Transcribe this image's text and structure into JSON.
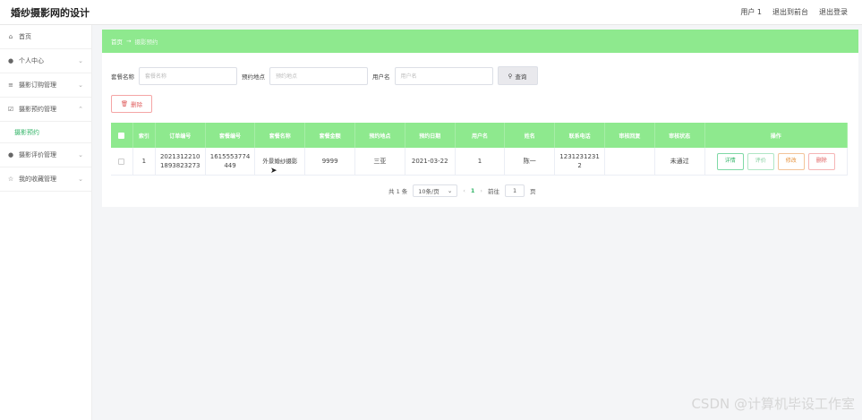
{
  "header": {
    "app_title": "婚纱摄影网的设计",
    "user": "用户 1",
    "back_front": "退出到前台",
    "logout": "退出登录"
  },
  "sidebar": {
    "items": [
      {
        "label": "首页",
        "icon": "home-icon"
      },
      {
        "label": "个人中心",
        "icon": "user-icon"
      },
      {
        "label": "摄影订购管理",
        "icon": "list-icon"
      },
      {
        "label": "摄影预约管理",
        "icon": "calendar-check-icon"
      },
      {
        "label": "摄影预约",
        "sub": true
      },
      {
        "label": "摄影评价管理",
        "icon": "user-icon"
      },
      {
        "label": "我的收藏管理",
        "icon": "star-icon"
      }
    ]
  },
  "breadcrumb": {
    "home": "首页",
    "arrow": "→",
    "current": "摄影预约"
  },
  "search": {
    "package_label": "套餐名称",
    "package_placeholder": "套餐名称",
    "location_label": "预约地点",
    "location_placeholder": "预约地点",
    "username_label": "用户名",
    "username_placeholder": "用户名",
    "search_button": "查询"
  },
  "toolbar": {
    "delete_button": "删除"
  },
  "table": {
    "columns": [
      "索引",
      "订单编号",
      "套餐编号",
      "套餐名称",
      "套餐金额",
      "预约地点",
      "预约日期",
      "用户名",
      "姓名",
      "联系电话",
      "审核回复",
      "审核状态",
      "操作"
    ],
    "rows": [
      {
        "index": "1",
        "order_no": "20213122101893823273",
        "package_no": "1615553774449",
        "package_name": "外景婚纱摄影",
        "amount": "9999",
        "location": "三亚",
        "date": "2021-03-22",
        "username": "1",
        "name": "陈一",
        "phone": "12312312312",
        "reply": "",
        "status": "未通过"
      }
    ],
    "actions": {
      "detail": "详情",
      "review": "评价",
      "edit": "修改",
      "delete": "删除"
    }
  },
  "pagination": {
    "total": "共 1 条",
    "page_size": "10条/页",
    "current_page": "1",
    "goto_label": "前往",
    "goto_value": "1",
    "page_unit": "页"
  },
  "watermark": "CSDN @计算机毕设工作室",
  "colors": {
    "accent": "#8ee98e",
    "link": "#35b569"
  }
}
